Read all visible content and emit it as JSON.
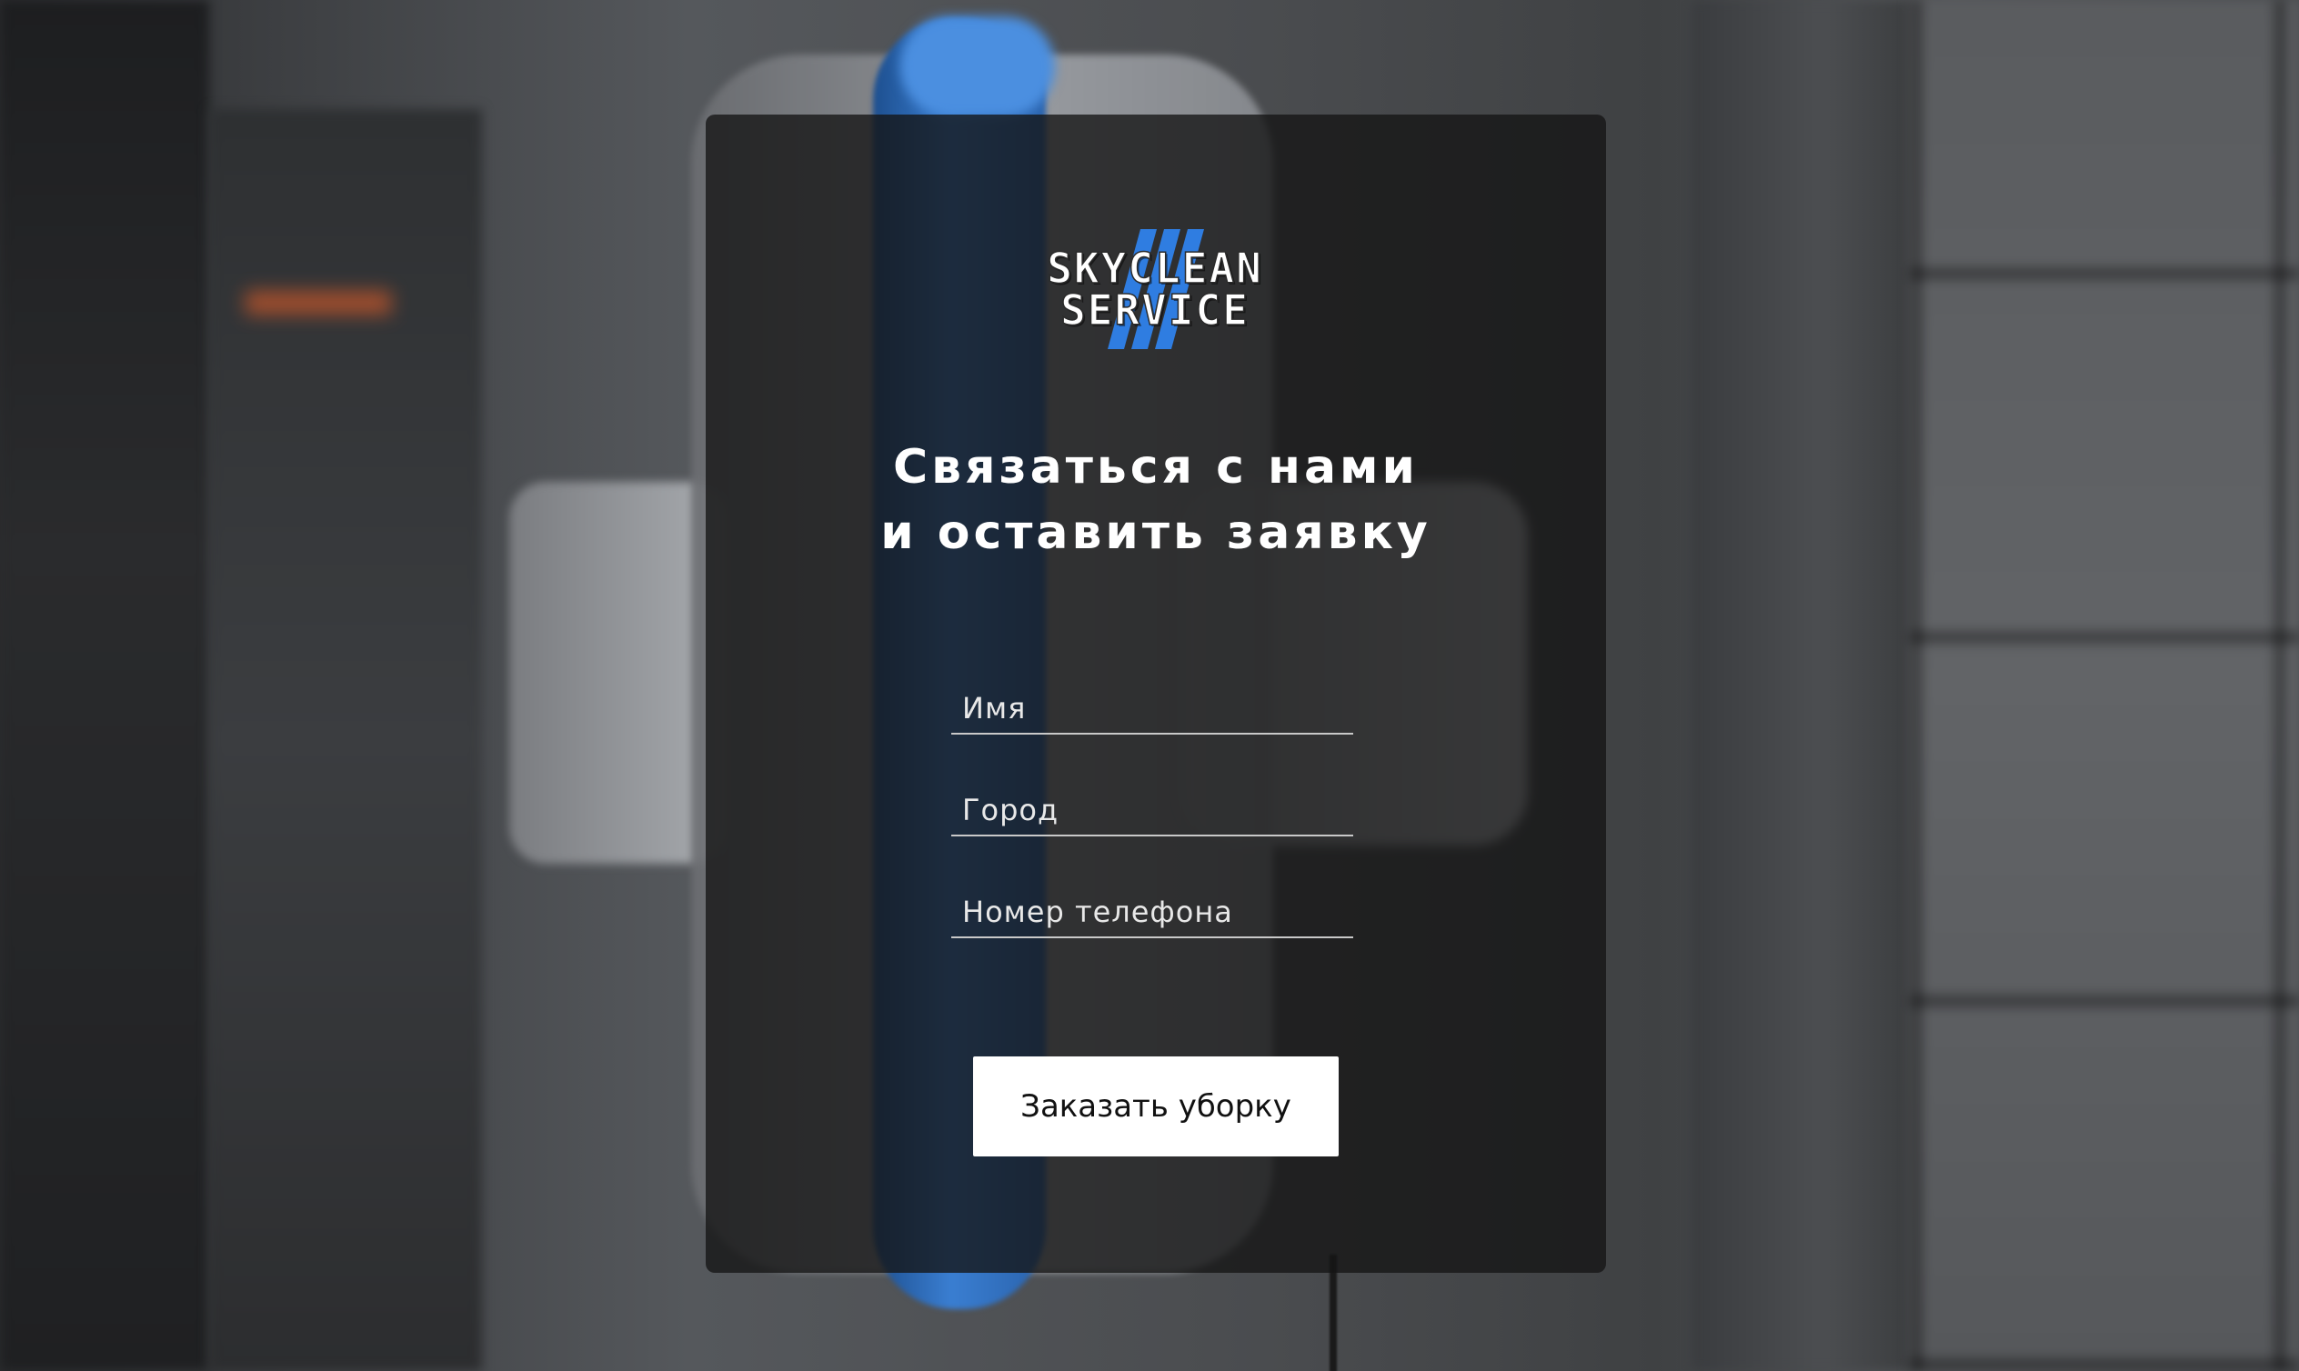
{
  "logo": {
    "line1": "SKYCLEAN",
    "line2": "SERVICE",
    "accent_color": "#2f7de1"
  },
  "form": {
    "heading_line1": "Связаться с нами",
    "heading_line2": "и оставить заявку",
    "name_placeholder": "Имя",
    "city_placeholder": "Город",
    "phone_placeholder": "Номер телефона",
    "submit_label": "Заказать уборку"
  }
}
